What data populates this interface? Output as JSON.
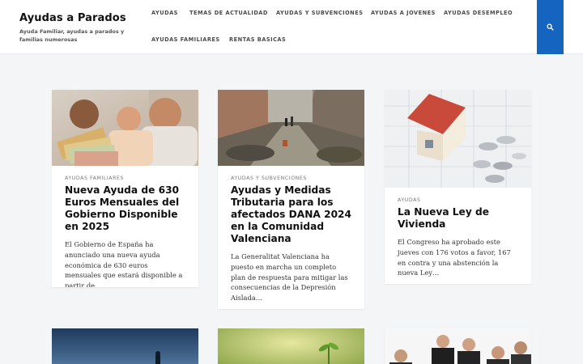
{
  "header": {
    "site_title": "Ayudas a Parados",
    "site_description": "Ayuda Familiar, ayudas a parados y familias numerosas",
    "nav": [
      "AYUDAS",
      "TEMAS DE ACTUALIDAD",
      "AYUDAS Y SUBVENCIONES",
      "AYUDAS A JOVENES",
      "AYUDAS DESEMPLEO",
      "AYUDAS FAMILIARES",
      "RENTAS BASICAS"
    ],
    "search_icon": "search-icon"
  },
  "posts": [
    {
      "category": "AYUDAS FAMILIARES",
      "title": "Nueva Ayuda de 630 Euros Mensuales del Gobierno Disponible en 2025",
      "excerpt": "El Gobierno de España ha anunciado una nueva ayuda económica de 630 euros mensuales que estará disponible a partir de…",
      "image": "family-with-euro-banknotes"
    },
    {
      "category": "AYUDAS Y SUBVENCIONES",
      "title": "Ayudas y Medidas Tributaria para los afectados DANA 2024 en la Comunidad Valenciana",
      "excerpt": "La Generalitat Valenciana ha puesto en marcha un completo plan de respuesta para mitigar las consecuencias de la Depresión Aislada…",
      "image": "flooded-street"
    },
    {
      "category": "AYUDAS",
      "title": "La Nueva Ley de Vivienda",
      "excerpt": "El Congreso ha aprobado este jueves con 176 votos a favor, 167 en contra y una abstención la nueva Ley…",
      "image": "house-model-on-blueprint-with-coins"
    },
    {
      "image": "silhouette-at-dusk"
    },
    {
      "image": "plant-sprout"
    },
    {
      "image": "business-team"
    }
  ],
  "colors": {
    "accent": "#1565c0",
    "background": "#f4f5f7"
  }
}
